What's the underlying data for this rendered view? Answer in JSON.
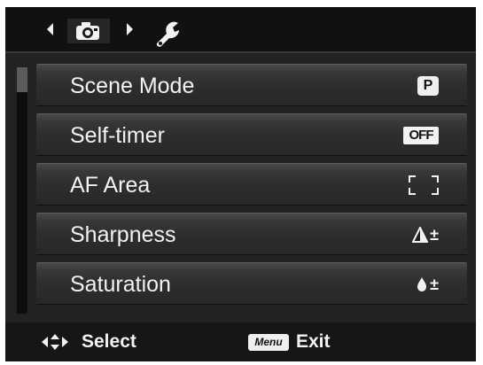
{
  "tabs": [
    {
      "name": "camera-tab",
      "icon": "camera-icon",
      "selected": true
    },
    {
      "name": "setup-tab",
      "icon": "wrench-icon",
      "selected": false
    }
  ],
  "menu": {
    "items": [
      {
        "label": "Scene Mode",
        "value_text": "P",
        "value_icon": "program-mode-icon"
      },
      {
        "label": "Self-timer",
        "value_text": "OFF",
        "value_icon": "self-timer-off-icon"
      },
      {
        "label": "AF Area",
        "value_text": "",
        "value_icon": "focus-area-icon"
      },
      {
        "label": "Sharpness",
        "value_text": "±",
        "value_icon": "sharpness-icon"
      },
      {
        "label": "Saturation",
        "value_text": "±",
        "value_icon": "saturation-icon"
      }
    ]
  },
  "footer": {
    "select_label": "Select",
    "menu_key_label": "Menu",
    "exit_label": "Exit"
  },
  "colors": {
    "screen": "#1b1b1b",
    "text": "#f2f2f2",
    "badge": "#efefef"
  }
}
